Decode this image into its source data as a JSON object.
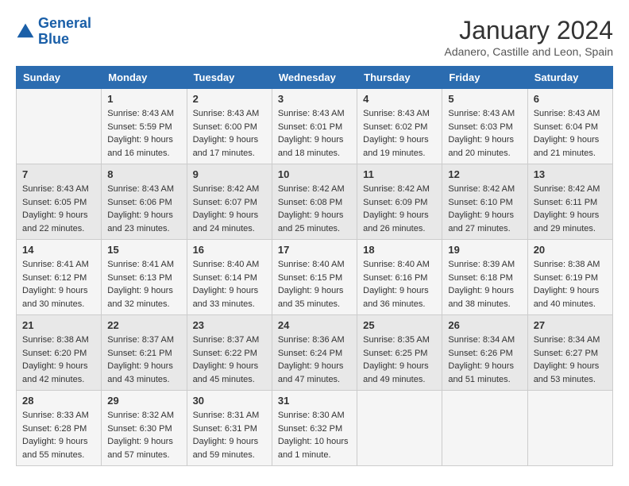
{
  "header": {
    "logo_line1": "General",
    "logo_line2": "Blue",
    "month": "January 2024",
    "location": "Adanero, Castille and Leon, Spain"
  },
  "days_of_week": [
    "Sunday",
    "Monday",
    "Tuesday",
    "Wednesday",
    "Thursday",
    "Friday",
    "Saturday"
  ],
  "weeks": [
    [
      {
        "day": "",
        "content": ""
      },
      {
        "day": "1",
        "content": "Sunrise: 8:43 AM\nSunset: 5:59 PM\nDaylight: 9 hours\nand 16 minutes."
      },
      {
        "day": "2",
        "content": "Sunrise: 8:43 AM\nSunset: 6:00 PM\nDaylight: 9 hours\nand 17 minutes."
      },
      {
        "day": "3",
        "content": "Sunrise: 8:43 AM\nSunset: 6:01 PM\nDaylight: 9 hours\nand 18 minutes."
      },
      {
        "day": "4",
        "content": "Sunrise: 8:43 AM\nSunset: 6:02 PM\nDaylight: 9 hours\nand 19 minutes."
      },
      {
        "day": "5",
        "content": "Sunrise: 8:43 AM\nSunset: 6:03 PM\nDaylight: 9 hours\nand 20 minutes."
      },
      {
        "day": "6",
        "content": "Sunrise: 8:43 AM\nSunset: 6:04 PM\nDaylight: 9 hours\nand 21 minutes."
      }
    ],
    [
      {
        "day": "7",
        "content": "Sunrise: 8:43 AM\nSunset: 6:05 PM\nDaylight: 9 hours\nand 22 minutes."
      },
      {
        "day": "8",
        "content": "Sunrise: 8:43 AM\nSunset: 6:06 PM\nDaylight: 9 hours\nand 23 minutes."
      },
      {
        "day": "9",
        "content": "Sunrise: 8:42 AM\nSunset: 6:07 PM\nDaylight: 9 hours\nand 24 minutes."
      },
      {
        "day": "10",
        "content": "Sunrise: 8:42 AM\nSunset: 6:08 PM\nDaylight: 9 hours\nand 25 minutes."
      },
      {
        "day": "11",
        "content": "Sunrise: 8:42 AM\nSunset: 6:09 PM\nDaylight: 9 hours\nand 26 minutes."
      },
      {
        "day": "12",
        "content": "Sunrise: 8:42 AM\nSunset: 6:10 PM\nDaylight: 9 hours\nand 27 minutes."
      },
      {
        "day": "13",
        "content": "Sunrise: 8:42 AM\nSunset: 6:11 PM\nDaylight: 9 hours\nand 29 minutes."
      }
    ],
    [
      {
        "day": "14",
        "content": "Sunrise: 8:41 AM\nSunset: 6:12 PM\nDaylight: 9 hours\nand 30 minutes."
      },
      {
        "day": "15",
        "content": "Sunrise: 8:41 AM\nSunset: 6:13 PM\nDaylight: 9 hours\nand 32 minutes."
      },
      {
        "day": "16",
        "content": "Sunrise: 8:40 AM\nSunset: 6:14 PM\nDaylight: 9 hours\nand 33 minutes."
      },
      {
        "day": "17",
        "content": "Sunrise: 8:40 AM\nSunset: 6:15 PM\nDaylight: 9 hours\nand 35 minutes."
      },
      {
        "day": "18",
        "content": "Sunrise: 8:40 AM\nSunset: 6:16 PM\nDaylight: 9 hours\nand 36 minutes."
      },
      {
        "day": "19",
        "content": "Sunrise: 8:39 AM\nSunset: 6:18 PM\nDaylight: 9 hours\nand 38 minutes."
      },
      {
        "day": "20",
        "content": "Sunrise: 8:38 AM\nSunset: 6:19 PM\nDaylight: 9 hours\nand 40 minutes."
      }
    ],
    [
      {
        "day": "21",
        "content": "Sunrise: 8:38 AM\nSunset: 6:20 PM\nDaylight: 9 hours\nand 42 minutes."
      },
      {
        "day": "22",
        "content": "Sunrise: 8:37 AM\nSunset: 6:21 PM\nDaylight: 9 hours\nand 43 minutes."
      },
      {
        "day": "23",
        "content": "Sunrise: 8:37 AM\nSunset: 6:22 PM\nDaylight: 9 hours\nand 45 minutes."
      },
      {
        "day": "24",
        "content": "Sunrise: 8:36 AM\nSunset: 6:24 PM\nDaylight: 9 hours\nand 47 minutes."
      },
      {
        "day": "25",
        "content": "Sunrise: 8:35 AM\nSunset: 6:25 PM\nDaylight: 9 hours\nand 49 minutes."
      },
      {
        "day": "26",
        "content": "Sunrise: 8:34 AM\nSunset: 6:26 PM\nDaylight: 9 hours\nand 51 minutes."
      },
      {
        "day": "27",
        "content": "Sunrise: 8:34 AM\nSunset: 6:27 PM\nDaylight: 9 hours\nand 53 minutes."
      }
    ],
    [
      {
        "day": "28",
        "content": "Sunrise: 8:33 AM\nSunset: 6:28 PM\nDaylight: 9 hours\nand 55 minutes."
      },
      {
        "day": "29",
        "content": "Sunrise: 8:32 AM\nSunset: 6:30 PM\nDaylight: 9 hours\nand 57 minutes."
      },
      {
        "day": "30",
        "content": "Sunrise: 8:31 AM\nSunset: 6:31 PM\nDaylight: 9 hours\nand 59 minutes."
      },
      {
        "day": "31",
        "content": "Sunrise: 8:30 AM\nSunset: 6:32 PM\nDaylight: 10 hours\nand 1 minute."
      },
      {
        "day": "",
        "content": ""
      },
      {
        "day": "",
        "content": ""
      },
      {
        "day": "",
        "content": ""
      }
    ]
  ]
}
